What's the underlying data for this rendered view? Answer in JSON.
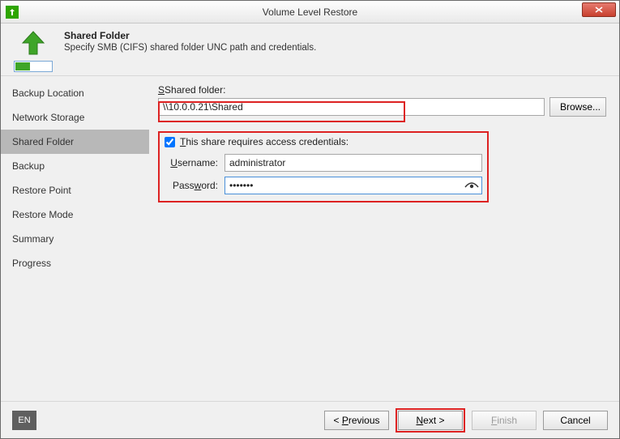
{
  "window": {
    "title": "Volume Level Restore"
  },
  "header": {
    "title": "Shared Folder",
    "subtitle": "Specify SMB (CIFS) shared folder UNC path and credentials."
  },
  "sidebar": {
    "items": [
      {
        "label": "Backup Location"
      },
      {
        "label": "Network Storage"
      },
      {
        "label": "Shared Folder"
      },
      {
        "label": "Backup"
      },
      {
        "label": "Restore Point"
      },
      {
        "label": "Restore Mode"
      },
      {
        "label": "Summary"
      },
      {
        "label": "Progress"
      }
    ],
    "active_index": 2
  },
  "form": {
    "shared_folder_label": "Shared folder:",
    "shared_folder_value": "\\\\10.0.0.21\\Shared",
    "browse_label": "Browse...",
    "requires_creds_label": "This share requires access credentials:",
    "requires_creds_checked": true,
    "username_label": "Username:",
    "username_value": "administrator",
    "password_label": "Password:",
    "password_value": "•••••••"
  },
  "footer": {
    "lang": "EN",
    "previous": "< Previous",
    "next": "Next >",
    "finish": "Finish",
    "cancel": "Cancel"
  }
}
